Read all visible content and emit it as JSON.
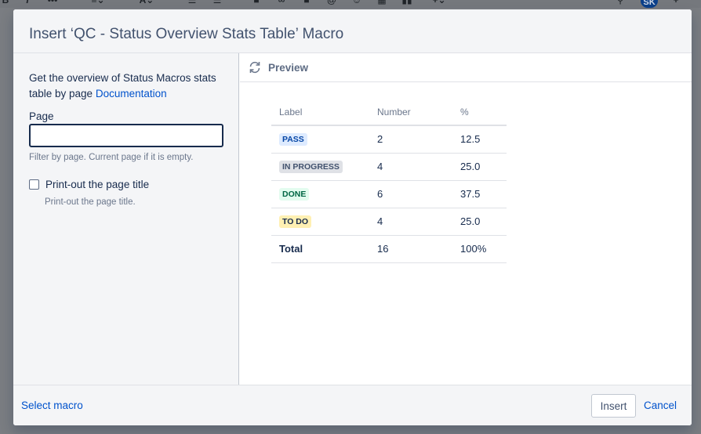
{
  "dialog": {
    "title": "Insert ‘QC - Status Overview Stats Table’ Macro"
  },
  "left": {
    "description": "Get the overview of Status Macros stats table by page",
    "doc_link": "Documentation",
    "page_label": "Page",
    "page_value": "",
    "page_hint": "Filter by page. Current page if it is empty.",
    "print_title_label": "Print-out the page title",
    "print_title_checked": false,
    "print_title_hint": "Print-out the page title."
  },
  "preview": {
    "label": "Preview",
    "headers": [
      "Label",
      "Number",
      "%"
    ],
    "rows": [
      {
        "label": "PASS",
        "number": "2",
        "percent": "12.5",
        "bg": "#deebff",
        "fg": "#0747a6"
      },
      {
        "label": "IN PROGRESS",
        "number": "4",
        "percent": "25.0",
        "bg": "#dfe1e6",
        "fg": "#42526e"
      },
      {
        "label": "DONE",
        "number": "6",
        "percent": "37.5",
        "bg": "#e3fcef",
        "fg": "#006644"
      },
      {
        "label": "TO DO",
        "number": "4",
        "percent": "25.0",
        "bg": "#fff0b3",
        "fg": "#172b4d"
      }
    ],
    "total": {
      "label": "Total",
      "number": "16",
      "percent": "100%"
    }
  },
  "footer": {
    "select_macro": "Select macro",
    "insert": "Insert",
    "cancel": "Cancel"
  },
  "editor": {
    "avatar_initials": "SK"
  },
  "colors": {
    "link": "#0052cc",
    "header_bg": "#f4f5f7"
  }
}
